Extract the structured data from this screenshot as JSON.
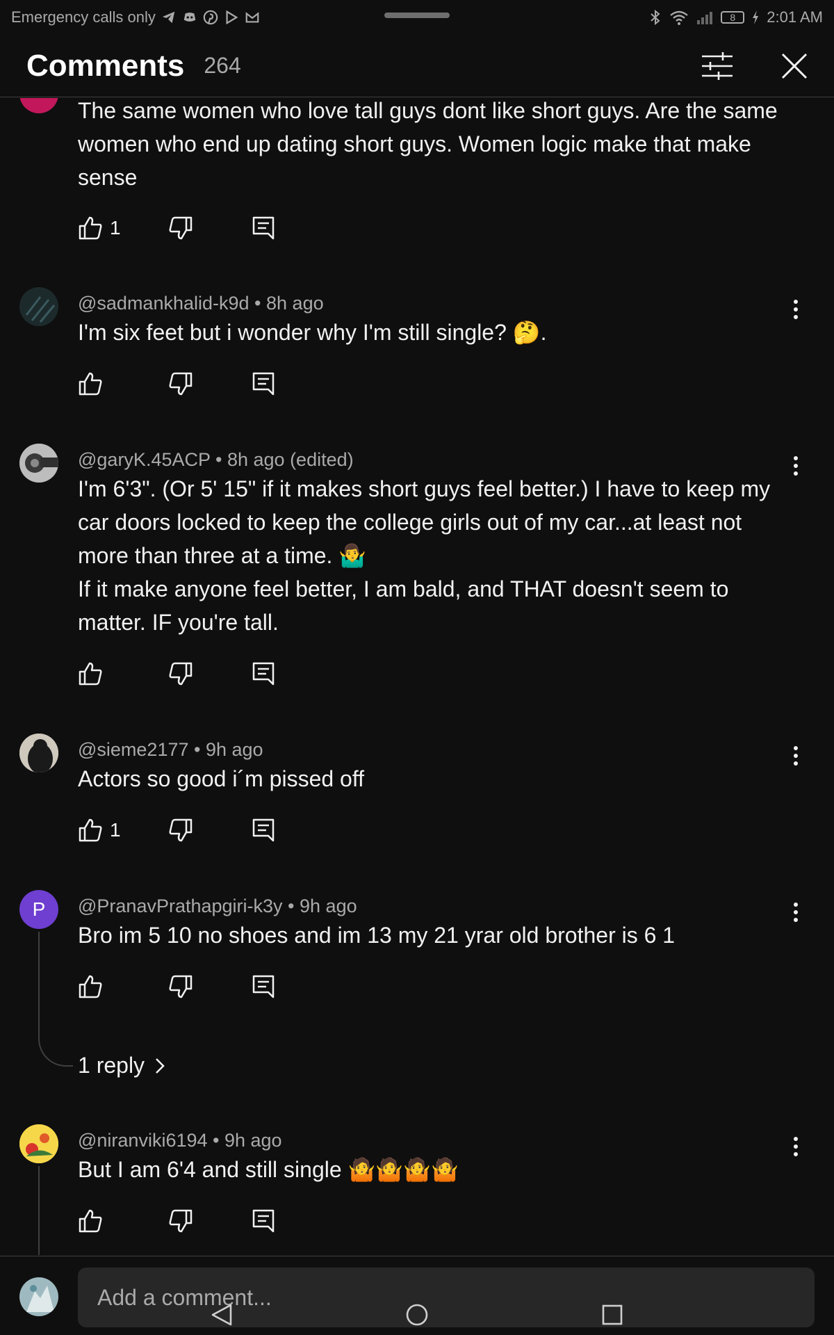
{
  "status_bar": {
    "carrier": "Emergency calls only",
    "battery": "8",
    "time": "2:01 AM"
  },
  "header": {
    "title": "Comments",
    "count": "264"
  },
  "comments": [
    {
      "text": "The same women who love tall guys dont like short guys. Are the same women who end up dating short guys. Women logic make that make sense",
      "likes": "1"
    },
    {
      "author": "@sadmankhalid-k9d",
      "time": "8h ago",
      "text": "I'm six feet but i wonder why I'm still single? 🤔.",
      "likes": ""
    },
    {
      "author": "@garyK.45ACP",
      "time": "8h ago (edited)",
      "text": "I'm 6'3\".  (Or 5' 15\" if it makes short guys feel better.)  I have to keep my car doors locked to keep the college girls out of my car...at least not more than three at a time. 🤷‍♂️\nIf it make anyone feel better, I am bald, and THAT doesn't seem to matter. IF you're tall.",
      "likes": ""
    },
    {
      "author": "@sieme2177",
      "time": "9h ago",
      "text": "Actors so good i´m pissed off",
      "likes": "1"
    },
    {
      "author": "@PranavPrathapgiri-k3y",
      "time": "9h ago",
      "text": "Bro im 5 10 no shoes and im 13 my 21 yrar old brother is 6 1",
      "likes": "",
      "avatar_letter": "P",
      "replies": "1 reply"
    },
    {
      "author": "@niranviki6194",
      "time": "9h ago",
      "text": "But I am 6'4 and still single 🤷🤷🤷🤷",
      "likes": ""
    }
  ],
  "composer": {
    "placeholder": "Add a comment..."
  },
  "colors": {
    "background": "#0f0f0f",
    "text": "#f1f1f1",
    "secondary": "#aaaaaa",
    "avatar_purple": "#6e3fd0"
  },
  "icons": [
    "telegram-icon",
    "discord-icon",
    "pinterest-icon",
    "play-store-icon",
    "gmail-icon",
    "bluetooth-icon",
    "wifi-icon",
    "signal-icon",
    "battery-icon",
    "filter-icon",
    "close-icon",
    "like-icon",
    "dislike-icon",
    "reply-icon",
    "more-vert-icon",
    "chevron-right-icon",
    "back-nav-icon",
    "home-nav-icon",
    "recents-nav-icon"
  ]
}
